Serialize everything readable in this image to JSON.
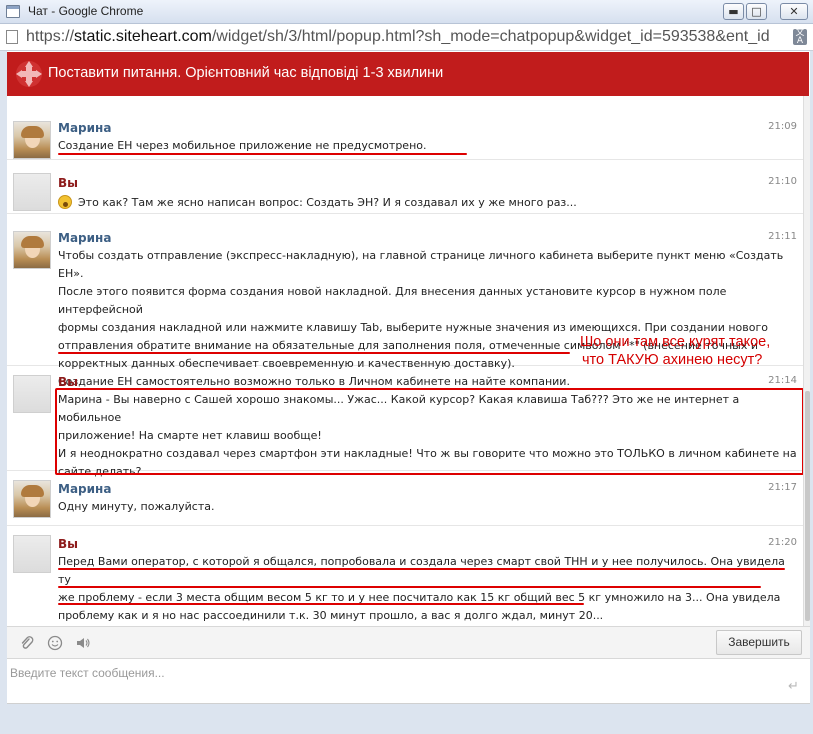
{
  "window": {
    "title": "Чат - Google Chrome",
    "minimize_label": "▬",
    "maximize_label": "□",
    "close_label": "✕"
  },
  "address": {
    "scheme_host_prefix": "https://",
    "host": "static.siteheart.com",
    "path": "/widget/sh/3/html/popup.html?sh_mode=chatpopup&widget_id=593538&ent_id"
  },
  "header": {
    "title": "Поставити питання. Орієнтовний час відповіді 1-3 хвилини"
  },
  "messages": [
    {
      "author": "Марина",
      "role": "operator",
      "time": "21:09",
      "paragraphs": [
        "Создание ЕН через мобильное приложение не предусмотрено."
      ]
    },
    {
      "author": "Вы",
      "role": "user",
      "time": "21:10",
      "paragraphs": [
        "Это как? Там же ясно написан вопрос: Создать ЭН? И я создавал их у же много раз..."
      ],
      "has_emoji": true
    },
    {
      "author": "Марина",
      "role": "operator",
      "time": "21:11",
      "paragraphs": [
        "Чтобы создать отправление (экспресс-накладную), на главной странице личного кабинета выберите пункт меню «Создать ЕН».",
        "После этого появится форма создания новой накладной. Для внесения данных установите курсор в нужном поле интерфейсной",
        "формы создания накладной или нажмите клавишу Tab, выберите нужные значения из имеющихся. При создании нового",
        "отправления обратите внимание на обязательные для заполнения поля, отмеченные символом \"*\" (внесение точных и",
        "корректных данных обеспечивает своевременную и качественную доставку).",
        "Создание ЕН самостоятельно возможно только в Личном кабинете на найте компании."
      ]
    },
    {
      "author": "Вы",
      "role": "user",
      "time": "21:14",
      "paragraphs": [
        "Марина - Вы наверно с Сашей хорошо знакомы... Ужас... Какой курсор? Какая клавиша Таб??? Это же не интернет а мобильное",
        "приложение! На смарте нет клавиш вообще!",
        "И я неоднократно создавал через смартфон эти накладные! Что ж вы говорите что можно это ТОЛЬКО в личном кабинете на",
        "сайте делать?"
      ]
    },
    {
      "author": "Марина",
      "role": "operator",
      "time": "21:17",
      "paragraphs": [
        "Одну минуту, пожалуйста."
      ]
    },
    {
      "author": "Вы",
      "role": "user",
      "time": "21:20",
      "paragraphs": [
        "Перед Вами оператор, с которой я общался, попробовала и создала через смарт свой ТНН и у нее получилось. Она увидела ту",
        "же проблему - если 3 места общим весом 5 кг то и у нее посчитало как 15 кг общий вес 5 кг умножило на 3... Она увидела",
        "проблему как и я но нас рассоединили т.к. 30 минут прошло, а вас я долго ждал, минут 20..."
      ]
    }
  ],
  "annotation": {
    "line1": "Шо они там все курят такое,",
    "line2": "что ТАКУЮ ахинею несут?"
  },
  "toolbar": {
    "finish_label": "Завершить"
  },
  "composer": {
    "placeholder": "Введите текст сообщения..."
  },
  "colors": {
    "header_bg": "#c11c1c",
    "operator_name": "#3d5f84",
    "user_name": "#8e1c1c",
    "annotation_red": "#d00000"
  }
}
